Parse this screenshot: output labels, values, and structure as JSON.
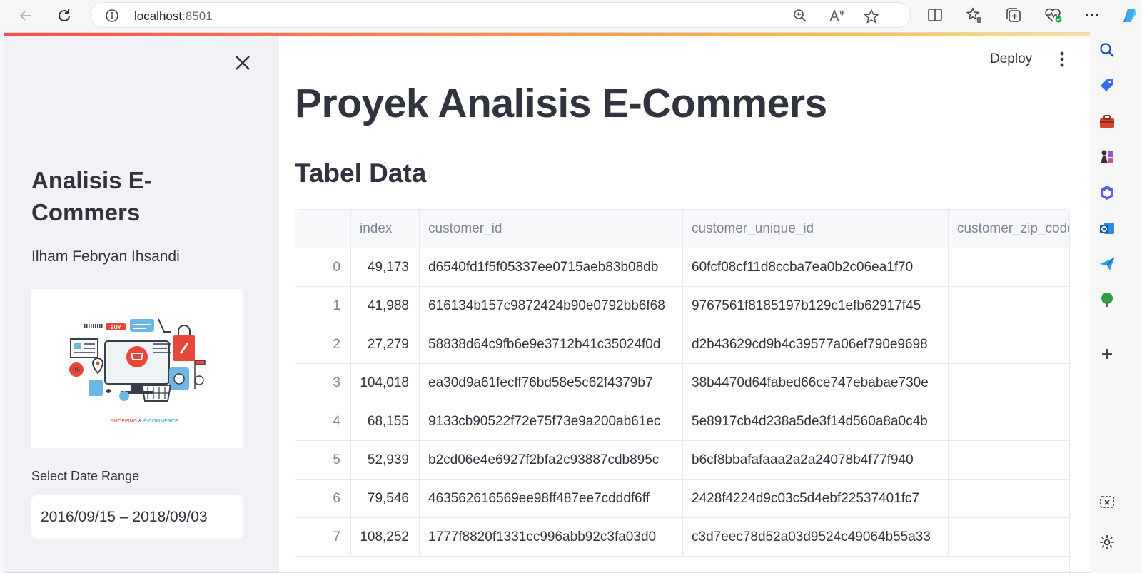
{
  "browser": {
    "url_host": "localhost",
    "url_port": ":8501"
  },
  "sidebar": {
    "title": "Analisis E-Commers",
    "author": "Ilham Febryan Ihsandi",
    "image_caption_1": "SHOPPING",
    "image_caption_amp": "&",
    "image_caption_2": "E-COMMERCE",
    "image_buy": "BUY",
    "date_label": "Select Date Range",
    "date_value": "2016/09/15 – 2018/09/03"
  },
  "main": {
    "deploy_label": "Deploy",
    "title": "Proyek Analisis E-Commers",
    "subtitle": "Tabel Data"
  },
  "table": {
    "columns": [
      "",
      "index",
      "customer_id",
      "customer_unique_id",
      "customer_zip_code"
    ],
    "rows": [
      [
        "0",
        "49,173",
        "d6540fd1f5f05337ee0715aeb83b08db",
        "60fcf08cf11d8ccba7ea0b2c06ea1f70"
      ],
      [
        "1",
        "41,988",
        "616134b157c9872424b90e0792bb6f68",
        "9767561f8185197b129c1efb62917f45"
      ],
      [
        "2",
        "27,279",
        "58838d64c9fb6e9e3712b41c35024f0d",
        "d2b43629cd9b4c39577a06ef790e9698"
      ],
      [
        "3",
        "104,018",
        "ea30d9a61fecff76bd58e5c62f4379b7",
        "38b4470d64fabed66ce747ebabae730e"
      ],
      [
        "4",
        "68,155",
        "9133cb90522f72e75f73e9a200ab61ec",
        "5e8917cb4d238a5de3f14d560a8a0c4b"
      ],
      [
        "5",
        "52,939",
        "b2cd06e4e6927f2bfa2c93887cdb895c",
        "b6cf8bbafafaaa2a2a24078b4f77f940"
      ],
      [
        "6",
        "79,546",
        "463562616569ee98ff487ee7cdddf6ff",
        "2428f4224d9c03c5d4ebf22537401fc7"
      ],
      [
        "7",
        "108,252",
        "1777f8820f1331cc996abb92c3fa03d0",
        "c3d7eec78d52a03d9524c49064b55a33"
      ]
    ]
  }
}
